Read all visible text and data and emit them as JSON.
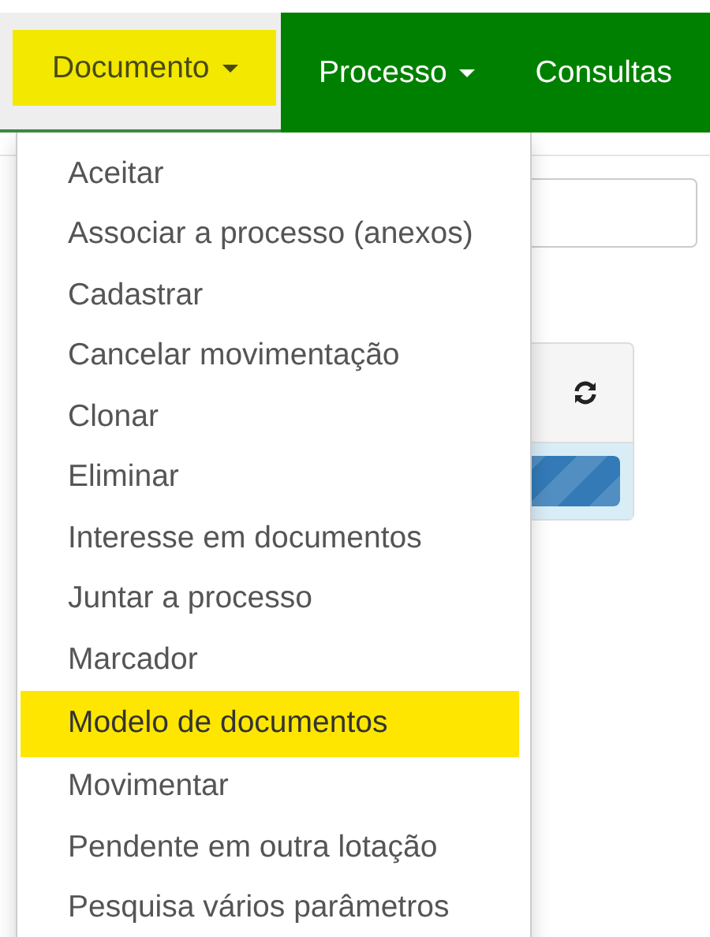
{
  "navbar": {
    "items": [
      {
        "label": "Documento",
        "dropdown": true,
        "selected": true
      },
      {
        "label": "Processo",
        "dropdown": true,
        "selected": false
      },
      {
        "label": "Consultas",
        "dropdown": false,
        "selected": false
      }
    ]
  },
  "background": {
    "progress": {
      "level": 1
    }
  },
  "menu": {
    "items": [
      {
        "label": "Aceitar",
        "selected": false
      },
      {
        "label": "Associar a processo (anexos)",
        "selected": false
      },
      {
        "label": "Cadastrar",
        "selected": false
      },
      {
        "label": "Cancelar movimentação",
        "selected": false
      },
      {
        "label": "Clonar",
        "selected": false
      },
      {
        "label": "Eliminar",
        "selected": false
      },
      {
        "label": "Interesse em documentos",
        "selected": false
      },
      {
        "label": "Juntar a processo",
        "selected": false
      },
      {
        "label": "Marcador",
        "selected": false
      },
      {
        "label": "Modelo de documentos",
        "selected": true
      },
      {
        "label": "Movimentar",
        "selected": false
      },
      {
        "label": "Pendente em outra lotação",
        "selected": false
      },
      {
        "label": "Pesquisa vários parâmetros",
        "selected": false
      }
    ]
  }
}
